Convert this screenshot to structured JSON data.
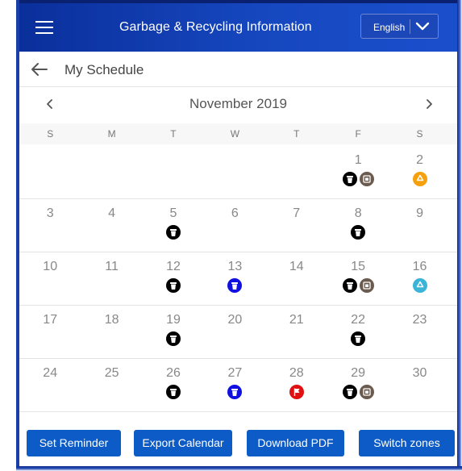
{
  "header": {
    "title": "Garbage & Recycling Information",
    "language": "English",
    "brand_color": "#1647bf"
  },
  "subheader": {
    "title": "My Schedule"
  },
  "calendar": {
    "month": "November 2019",
    "weekdays": [
      "S",
      "M",
      "T",
      "W",
      "T",
      "F",
      "S"
    ],
    "weeks": [
      [
        {
          "day": "",
          "icons": []
        },
        {
          "day": "",
          "icons": []
        },
        {
          "day": "",
          "icons": []
        },
        {
          "day": "",
          "icons": []
        },
        {
          "day": "",
          "icons": []
        },
        {
          "day": "1",
          "icons": [
            "garbage",
            "bulky"
          ]
        },
        {
          "day": "2",
          "icons": [
            "recycle-orange"
          ]
        }
      ],
      [
        {
          "day": "3",
          "icons": []
        },
        {
          "day": "4",
          "icons": []
        },
        {
          "day": "5",
          "icons": [
            "garbage"
          ]
        },
        {
          "day": "6",
          "icons": []
        },
        {
          "day": "7",
          "icons": []
        },
        {
          "day": "8",
          "icons": [
            "garbage"
          ]
        },
        {
          "day": "9",
          "icons": []
        }
      ],
      [
        {
          "day": "10",
          "icons": []
        },
        {
          "day": "11",
          "icons": []
        },
        {
          "day": "12",
          "icons": [
            "garbage"
          ]
        },
        {
          "day": "13",
          "icons": [
            "blue-bin"
          ]
        },
        {
          "day": "14",
          "icons": []
        },
        {
          "day": "15",
          "icons": [
            "garbage",
            "bulky"
          ]
        },
        {
          "day": "16",
          "icons": [
            "recycle-teal"
          ]
        }
      ],
      [
        {
          "day": "17",
          "icons": []
        },
        {
          "day": "18",
          "icons": []
        },
        {
          "day": "19",
          "icons": [
            "garbage"
          ]
        },
        {
          "day": "20",
          "icons": []
        },
        {
          "day": "21",
          "icons": []
        },
        {
          "day": "22",
          "icons": [
            "garbage"
          ]
        },
        {
          "day": "23",
          "icons": []
        }
      ],
      [
        {
          "day": "24",
          "icons": []
        },
        {
          "day": "25",
          "icons": []
        },
        {
          "day": "26",
          "icons": [
            "garbage"
          ]
        },
        {
          "day": "27",
          "icons": [
            "blue-bin"
          ]
        },
        {
          "day": "28",
          "icons": [
            "flag-red"
          ]
        },
        {
          "day": "29",
          "icons": [
            "garbage",
            "bulky"
          ]
        },
        {
          "day": "30",
          "icons": []
        }
      ]
    ],
    "icon_colors": {
      "garbage": "#000000",
      "bulky": "#6b5a4e",
      "recycle-orange": "#f5a10e",
      "recycle-teal": "#3bb4d8",
      "blue-bin": "#1010e0",
      "flag-red": "#e01010"
    }
  },
  "actions": {
    "set_reminder": "Set Reminder",
    "export_calendar": "Export Calendar",
    "download_pdf": "Download PDF",
    "switch_zones": "Switch zones",
    "button_color": "#0d5bc6"
  }
}
